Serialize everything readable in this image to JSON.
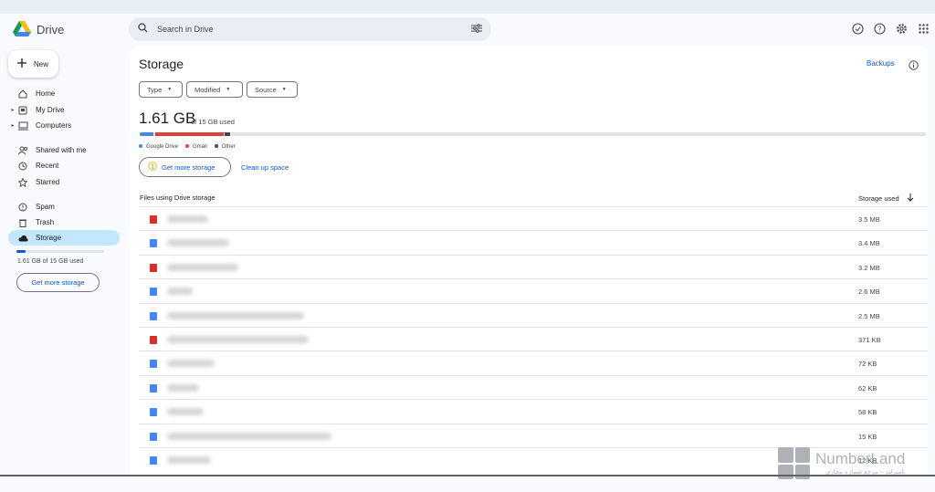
{
  "app": {
    "name": "Drive"
  },
  "search": {
    "placeholder": "Search in Drive"
  },
  "sidebar": {
    "new_label": "New",
    "items": [
      {
        "label": "Home"
      },
      {
        "label": "My Drive"
      },
      {
        "label": "Computers"
      },
      {
        "label": "Shared with me"
      },
      {
        "label": "Recent"
      },
      {
        "label": "Starred"
      },
      {
        "label": "Spam"
      },
      {
        "label": "Trash"
      },
      {
        "label": "Storage"
      }
    ],
    "used_text": "1.61 GB of 15 GB used",
    "used_fraction": 0.107,
    "get_more": "Get more storage"
  },
  "main": {
    "title": "Storage",
    "backups": "Backups",
    "filters": {
      "type": "Type",
      "modified": "Modified",
      "source": "Source"
    },
    "used_big": "1.61 GB",
    "used_small": "of 15 GB used",
    "bar_fractions": {
      "google_drive": 0.017,
      "gmail": 0.087,
      "other": 0.007
    },
    "legend": {
      "google_drive": "Google Drive",
      "gmail": "Gmail",
      "other": "Other"
    },
    "get_more": "Get more storage",
    "clean_up": "Clean up space",
    "files_header": "Files using Drive storage",
    "storage_header": "Storage used",
    "files": [
      {
        "size": "3.5 MB",
        "icon": "pdf-icon"
      },
      {
        "size": "3.4 MB",
        "icon": "doc-icon"
      },
      {
        "size": "3.2 MB",
        "icon": "image-icon"
      },
      {
        "size": "2.6 MB",
        "icon": "doc-icon"
      },
      {
        "size": "2.5 MB",
        "icon": "doc-icon"
      },
      {
        "size": "371 KB",
        "icon": "video-icon"
      },
      {
        "size": "72 KB",
        "icon": "doc-icon"
      },
      {
        "size": "62 KB",
        "icon": "doc-icon"
      },
      {
        "size": "58 KB",
        "icon": "doc-icon"
      },
      {
        "size": "15 KB",
        "icon": "doc-icon"
      },
      {
        "size": "12 KB",
        "icon": "doc-icon"
      }
    ]
  },
  "colors": {
    "accent": "#0b57d0",
    "google_drive": "#4285f4",
    "gmail": "#db4437",
    "other": "#444746",
    "active_nav": "#c2e7ff"
  },
  "watermark": {
    "text": "NumberLand",
    "subtitle": "نامبرلند – مرجع شماره مجازی"
  }
}
